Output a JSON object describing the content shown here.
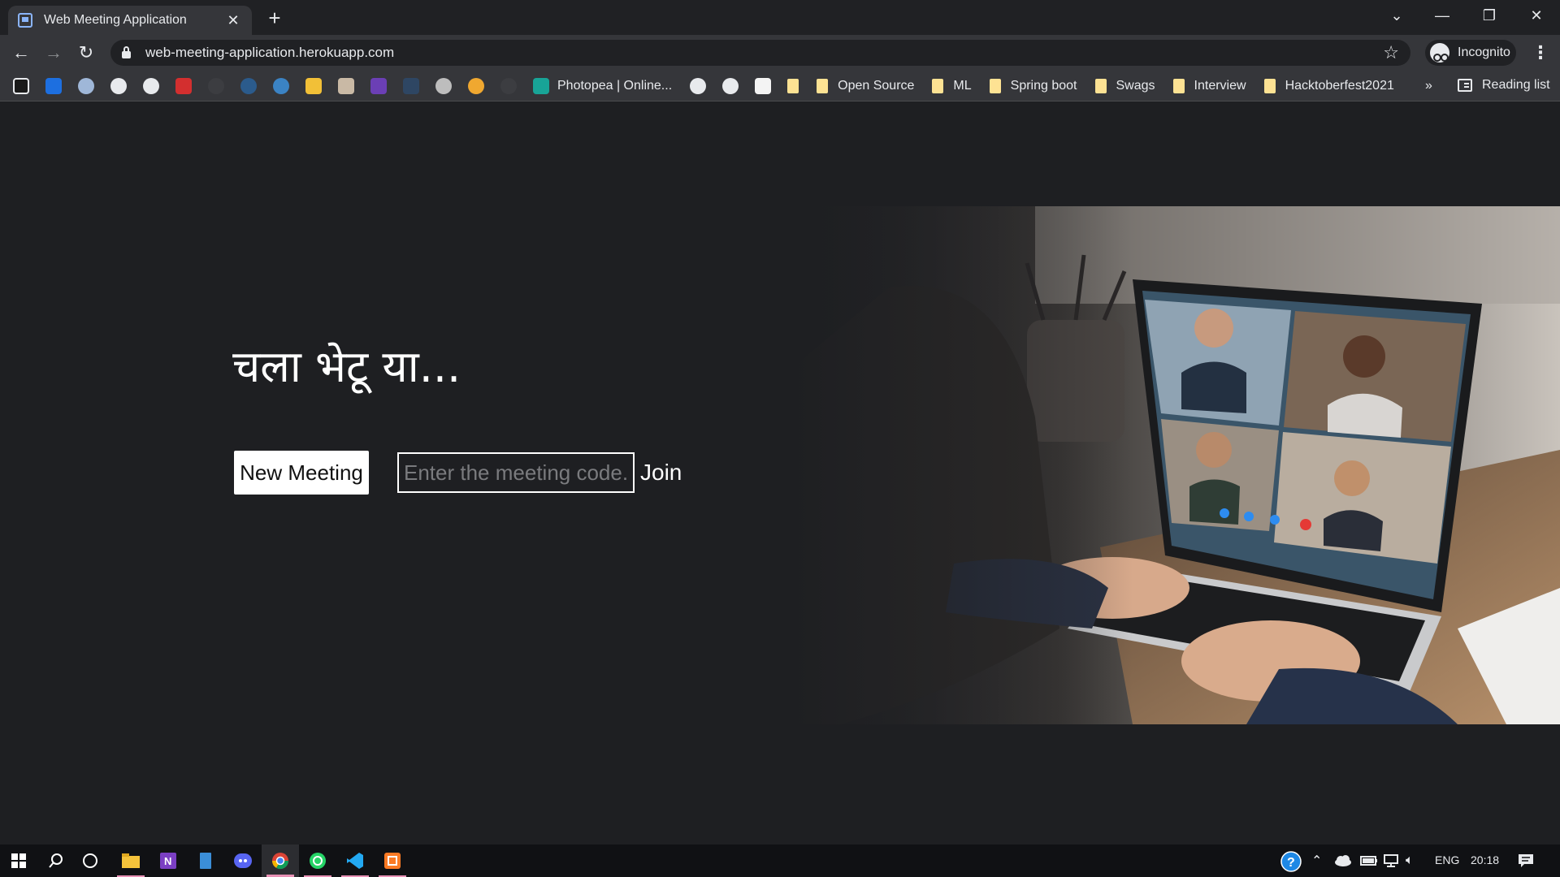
{
  "browser": {
    "tab_title": "Web Meeting Application",
    "tab_close": "✕",
    "new_tab": "+",
    "url": "web-meeting-application.herokuapp.com",
    "profile_label": "Incognito",
    "reading_list": "Reading list",
    "bookmarks_overflow": "»",
    "bookmarks": [
      {
        "label": "Photopea | Online...",
        "icon": "photopea-icon"
      },
      {
        "label": "Open Source",
        "icon": "folder-icon"
      },
      {
        "label": "ML",
        "icon": "folder-icon"
      },
      {
        "label": "Spring boot",
        "icon": "folder-icon"
      },
      {
        "label": "Swags",
        "icon": "folder-icon"
      },
      {
        "label": "Interview",
        "icon": "folder-icon"
      },
      {
        "label": "Hacktoberfest2021",
        "icon": "folder-icon"
      }
    ]
  },
  "page": {
    "heading": "चला भेटू या...",
    "new_meeting_label": "New Meeting",
    "meeting_code_placeholder": "Enter the meeting code...",
    "join_label": "Join"
  },
  "taskbar": {
    "language": "ENG",
    "time": "20:18",
    "apps": [
      "windows-start-icon",
      "search-icon",
      "cortana-icon",
      "file-explorer-icon",
      "onenote-icon",
      "notepad-icon",
      "discord-icon",
      "chrome-icon",
      "whatsapp-icon",
      "vscode-icon",
      "xampp-icon"
    ]
  },
  "colors": {
    "page_background": "#1e1f22",
    "browser_chrome": "#35363a",
    "tab_strip": "#202124",
    "taskbar": "#101114"
  }
}
